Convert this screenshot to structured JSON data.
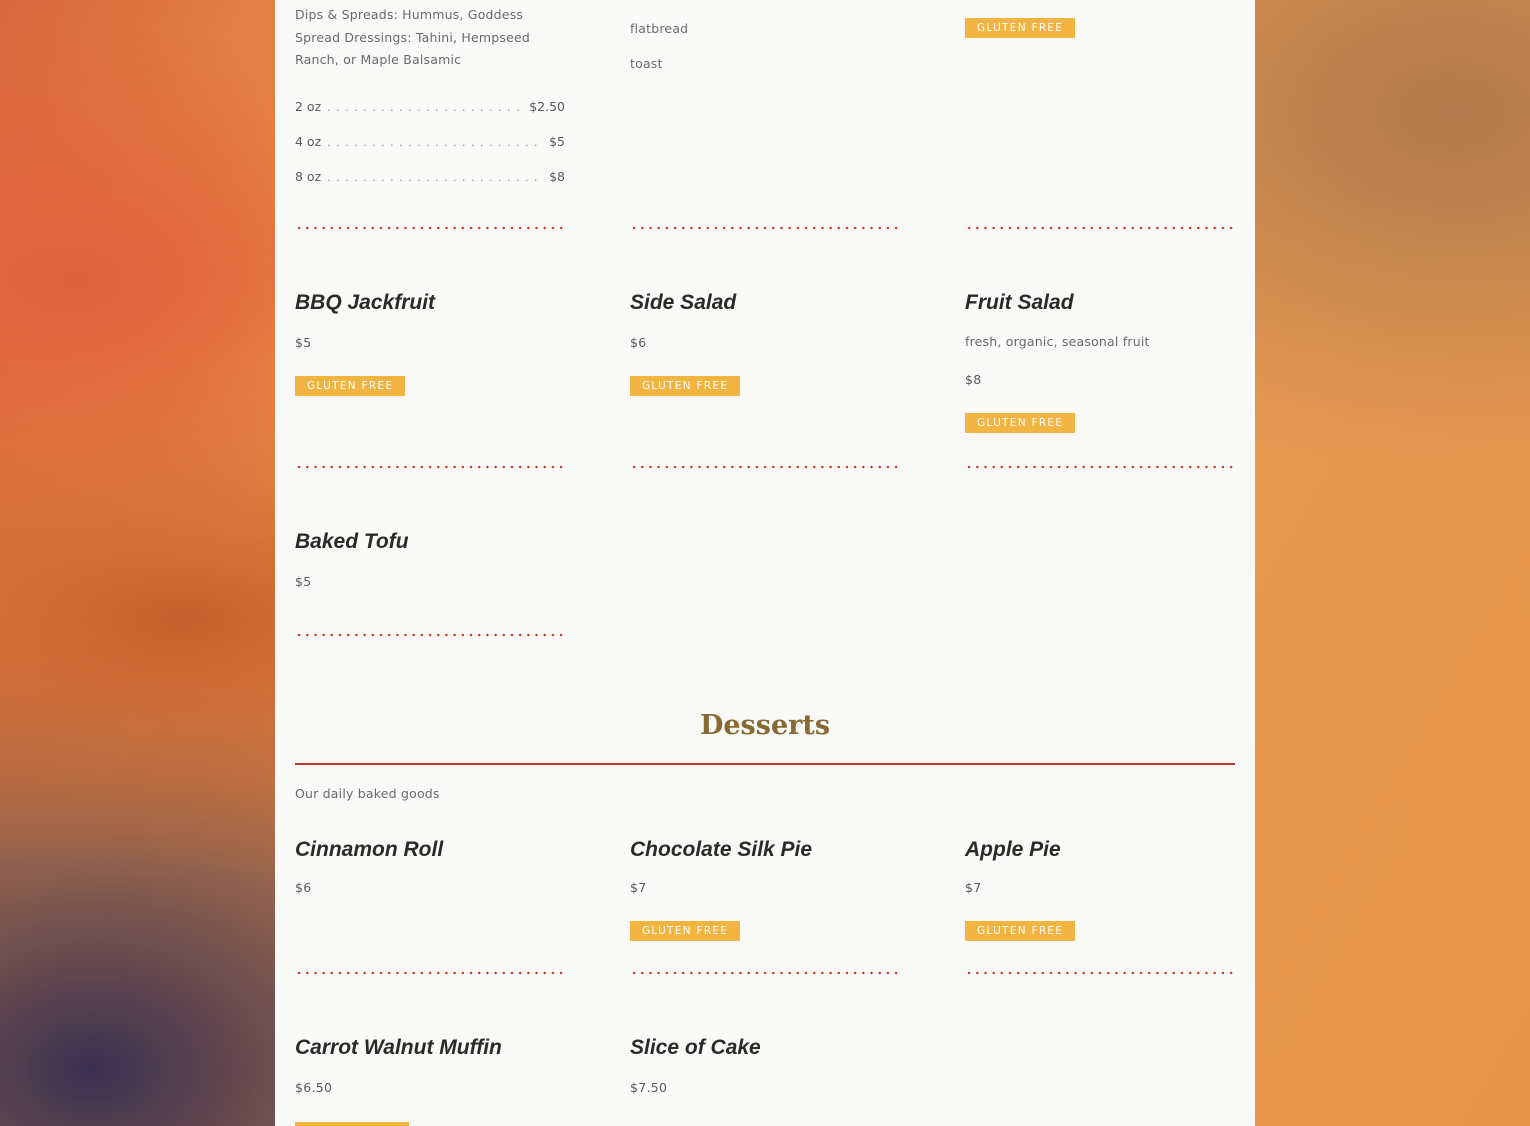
{
  "top_items": {
    "dips": {
      "desc_line1": "Dips & Spreads: Hummus, Goddess",
      "desc_line2": "Spread Dressings: Tahini, Hempseed",
      "desc_line3": "Ranch, or Maple Balsamic",
      "sizes": [
        {
          "size": "2 oz",
          "price": "$2.50"
        },
        {
          "size": "4 oz",
          "price": "$5"
        },
        {
          "size": "8 oz",
          "price": "$8"
        }
      ]
    },
    "bread": {
      "line1": "flatbread",
      "line2": "toast"
    },
    "third": {
      "badge": "GLUTEN FREE"
    }
  },
  "sides": [
    {
      "name": "BBQ Jackfruit",
      "price": "$5",
      "badge": "GLUTEN FREE"
    },
    {
      "name": "Side Salad",
      "price": "$6",
      "badge": "GLUTEN FREE"
    },
    {
      "name": "Fruit Salad",
      "desc": "fresh, organic, seasonal fruit",
      "price": "$8",
      "badge": "GLUTEN FREE"
    },
    {
      "name": "Baked Tofu",
      "price": "$5"
    }
  ],
  "desserts_section": {
    "title": "Desserts",
    "subtitle": "Our daily baked goods",
    "items": [
      {
        "name": "Cinnamon Roll",
        "price": "$6"
      },
      {
        "name": "Chocolate Silk Pie",
        "price": "$7",
        "badge": "GLUTEN FREE"
      },
      {
        "name": "Apple Pie",
        "price": "$7",
        "badge": "GLUTEN FREE"
      },
      {
        "name": "Carrot Walnut Muffin",
        "price": "$6.50"
      },
      {
        "name": "Slice of Cake",
        "price": "$7.50"
      }
    ]
  },
  "colors": {
    "badge": "#f2b440",
    "divider": "#c03a2c",
    "section_title": "#8a6a34"
  }
}
